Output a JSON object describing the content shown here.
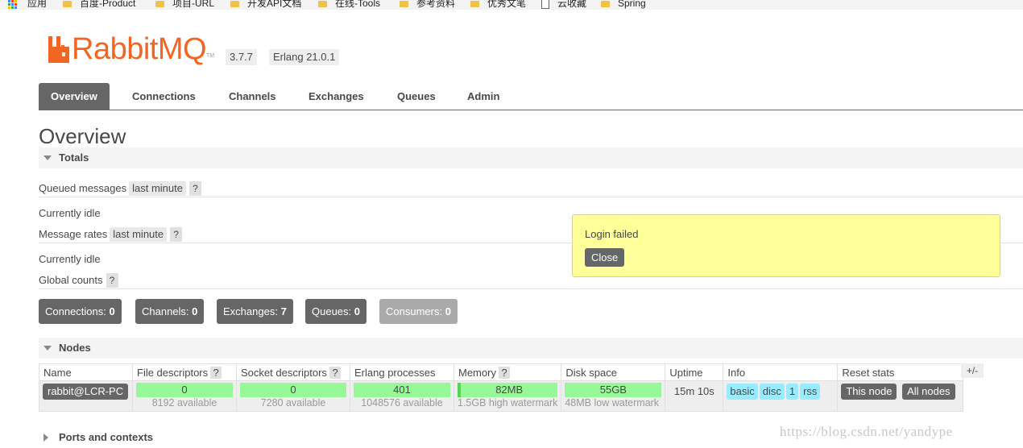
{
  "bookmarks": [
    {
      "label": "应用",
      "icon": "apps-icon"
    },
    {
      "label": "百度-Product",
      "icon": "folder-icon"
    },
    {
      "label": "项目-URL",
      "icon": "folder-icon"
    },
    {
      "label": "开发API文档",
      "icon": "folder-icon"
    },
    {
      "label": "在线-Tools",
      "icon": "folder-icon"
    },
    {
      "label": "参考资料",
      "icon": "folder-icon"
    },
    {
      "label": "优秀文笔",
      "icon": "folder-icon"
    },
    {
      "label": "云收藏",
      "icon": "page-icon"
    },
    {
      "label": "Spring",
      "icon": "folder-icon"
    }
  ],
  "header": {
    "logo_text": "RabbitMQ",
    "logo_tm": "TM",
    "version": "3.7.7",
    "erlang": "Erlang 21.0.1",
    "brand_color": "#f26522"
  },
  "tabs": [
    {
      "label": "Overview",
      "active": true
    },
    {
      "label": "Connections"
    },
    {
      "label": "Channels"
    },
    {
      "label": "Exchanges"
    },
    {
      "label": "Queues"
    },
    {
      "label": "Admin"
    }
  ],
  "page_title": "Overview",
  "totals": {
    "section_label": "Totals",
    "queued_messages_label": "Queued messages",
    "queued_range": "last minute",
    "help": "?",
    "queued_status": "Currently idle",
    "message_rates_label": "Message rates",
    "rates_range": "last minute",
    "rates_status": "Currently idle",
    "global_counts_label": "Global counts"
  },
  "counts": [
    {
      "label": "Connections:",
      "value": "0"
    },
    {
      "label": "Channels:",
      "value": "0"
    },
    {
      "label": "Exchanges:",
      "value": "7"
    },
    {
      "label": "Queues:",
      "value": "0"
    },
    {
      "label": "Consumers:",
      "value": "0"
    }
  ],
  "popup": {
    "message": "Login failed",
    "close_label": "Close"
  },
  "nodes": {
    "section_label": "Nodes",
    "columns": [
      "Name",
      "File descriptors",
      "Socket descriptors",
      "Erlang processes",
      "Memory",
      "Disk space",
      "Uptime",
      "Info",
      "Reset stats"
    ],
    "plus_minus": "+/-",
    "row": {
      "name": "rabbit@LCR-PC",
      "file_descriptors": "0",
      "file_descriptors_available": "8192 available",
      "socket_descriptors": "0",
      "socket_descriptors_available": "7280 available",
      "erlang_processes": "401",
      "erlang_processes_available": "1048576 available",
      "memory": "82MB",
      "memory_watermark": "1.5GB high watermark",
      "disk_space": "55GB",
      "disk_watermark": "48MB low watermark",
      "uptime": "15m 10s",
      "info_tags": [
        "basic",
        "disc",
        "1",
        "rss"
      ],
      "reset_this": "This node",
      "reset_all": "All nodes"
    }
  },
  "ports_section_label": "Ports and contexts",
  "watermark": "https://blog.csdn.net/yandype"
}
